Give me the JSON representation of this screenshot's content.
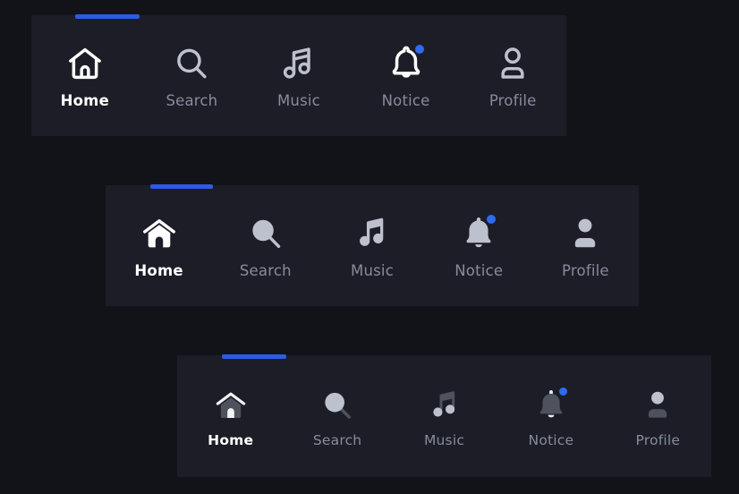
{
  "page": {
    "background_color": "#121319",
    "bar_background_color": "#1c1d26",
    "accent_color": "#2b5ce6",
    "badge_color": "#2f6bf0",
    "active_label_color": "#ffffff",
    "inactive_label_color": "#878c9c"
  },
  "navbars": [
    {
      "id": "bar-outline",
      "style_name": "outline",
      "active_index": 0,
      "items": [
        {
          "label": "Home",
          "icon": "home-icon",
          "active": true,
          "badge": false
        },
        {
          "label": "Search",
          "icon": "search-icon",
          "active": false,
          "badge": false
        },
        {
          "label": "Music",
          "icon": "music-icon",
          "active": false,
          "badge": false
        },
        {
          "label": "Notice",
          "icon": "bell-icon",
          "active": false,
          "badge": true
        },
        {
          "label": "Profile",
          "icon": "profile-icon",
          "active": false,
          "badge": false
        }
      ]
    },
    {
      "id": "bar-solid",
      "style_name": "solid",
      "active_index": 0,
      "items": [
        {
          "label": "Home",
          "icon": "home-icon",
          "active": true,
          "badge": false
        },
        {
          "label": "Search",
          "icon": "search-icon",
          "active": false,
          "badge": false
        },
        {
          "label": "Music",
          "icon": "music-icon",
          "active": false,
          "badge": false
        },
        {
          "label": "Notice",
          "icon": "bell-icon",
          "active": false,
          "badge": true
        },
        {
          "label": "Profile",
          "icon": "profile-icon",
          "active": false,
          "badge": false
        }
      ]
    },
    {
      "id": "bar-duotone",
      "style_name": "duotone",
      "active_index": 0,
      "items": [
        {
          "label": "Home",
          "icon": "home-icon",
          "active": true,
          "badge": false
        },
        {
          "label": "Search",
          "icon": "search-icon",
          "active": false,
          "badge": false
        },
        {
          "label": "Music",
          "icon": "music-icon",
          "active": false,
          "badge": false
        },
        {
          "label": "Notice",
          "icon": "bell-icon",
          "active": false,
          "badge": true
        },
        {
          "label": "Profile",
          "icon": "profile-icon",
          "active": false,
          "badge": false
        }
      ]
    }
  ]
}
